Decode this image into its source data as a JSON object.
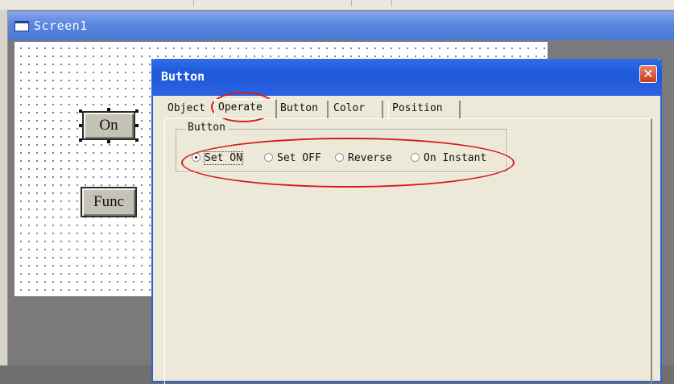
{
  "screen_window": {
    "title": "Screen1",
    "icon": "window-icon",
    "canvas_buttons": [
      "On",
      "Func"
    ]
  },
  "dialog": {
    "title": "Button",
    "close_icon": "close-icon",
    "close_glyph": "✕",
    "tabs": [
      {
        "label": "Object",
        "selected": false
      },
      {
        "label": "Operate",
        "selected": true
      },
      {
        "label": "Button",
        "selected": false
      },
      {
        "label": "Color",
        "selected": false
      },
      {
        "label": "Position",
        "selected": false
      }
    ],
    "group": {
      "label": "Button",
      "options": [
        {
          "label": "Set ON",
          "checked": true
        },
        {
          "label": "Set OFF",
          "checked": false
        },
        {
          "label": "Reverse",
          "checked": false
        },
        {
          "label": "On Instant",
          "checked": false
        }
      ]
    }
  },
  "colors": {
    "title_bar": "#2b63e0",
    "dialog_background": "#ece9d8",
    "annotation": "#d61b1b",
    "close_button": "#c73a1f"
  }
}
